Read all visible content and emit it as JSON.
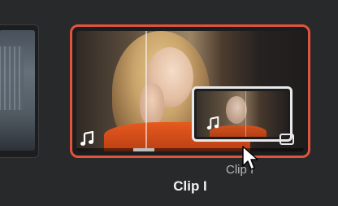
{
  "clips": {
    "selected_clip_label": "Clip I",
    "drag_label": "Clip I"
  },
  "icons": {
    "audio": "music-note-icon",
    "cursor": "mouse-pointer-icon",
    "scale": "resize-corner-icon"
  },
  "colors": {
    "selection_border": "#e0543c",
    "background": "#28292b",
    "label_text": "#f2f2f2"
  }
}
